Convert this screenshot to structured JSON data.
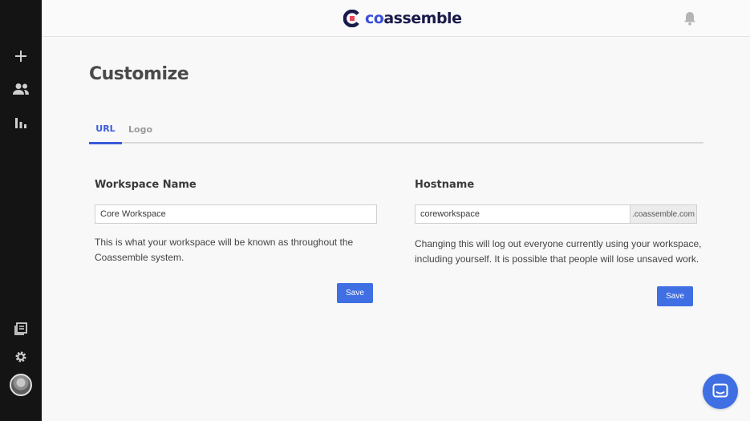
{
  "brand": {
    "logo_prefix": "co",
    "logo_suffix": "assemble",
    "accent_color": "#3f6fe3",
    "brand_color": "#1a1a4b"
  },
  "sidebar": {
    "items": [
      {
        "icon": "plus-icon"
      },
      {
        "icon": "people-icon"
      },
      {
        "icon": "bar-chart-icon"
      },
      {
        "icon": "library-icon"
      },
      {
        "icon": "gear-icon"
      }
    ],
    "avatar": "avatar"
  },
  "header": {
    "notification_icon": "bell-icon"
  },
  "page": {
    "title": "Customize"
  },
  "tabs": [
    {
      "label": "URL",
      "active": true
    },
    {
      "label": "Logo",
      "active": false
    }
  ],
  "workspace": {
    "heading": "Workspace Name",
    "value": "Core Workspace",
    "help_line1": "This is what your workspace will be known as throughout the",
    "help_line2": "Coassemble system.",
    "save_label": "Save"
  },
  "hostname": {
    "heading": "Hostname",
    "value": "coreworkspace",
    "suffix": ".coassemble.com",
    "help_line1": "Changing this will log out everyone currently using your workspace,",
    "help_line2": "including yourself. It is possible that people will lose unsaved work.",
    "save_label": "Save"
  },
  "chat": {
    "icon": "chat-icon"
  }
}
